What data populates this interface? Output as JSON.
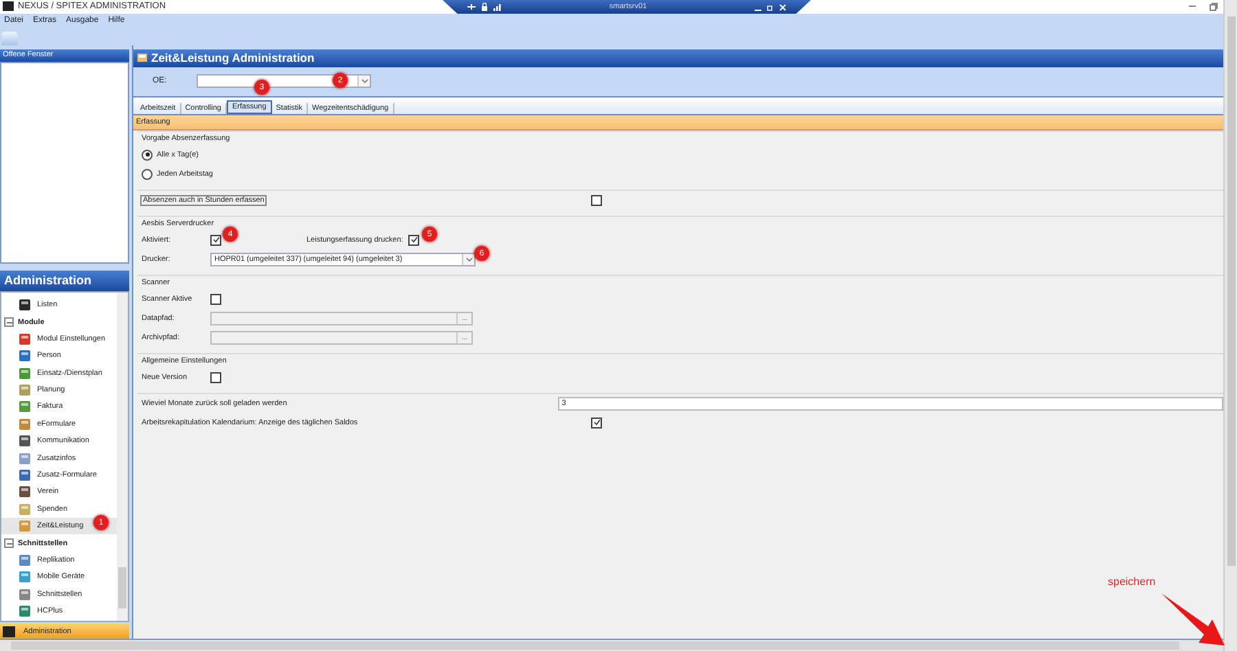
{
  "window": {
    "title": "NEXUS / SPITEX ADMINISTRATION",
    "remote_host": "smartsrv01"
  },
  "menu": [
    "Datei",
    "Extras",
    "Ausgabe",
    "Hilfe"
  ],
  "open_windows": {
    "title": "Offene Fenster"
  },
  "navigation": {
    "title": "Administration",
    "items": [
      {
        "kind": "item",
        "label": "Listen",
        "selected": false
      },
      {
        "kind": "group",
        "label": "Module",
        "expanded": true,
        "children": [
          {
            "kind": "item",
            "label": "Modul Einstellungen",
            "selected": false
          },
          {
            "kind": "item",
            "label": "Person",
            "selected": false
          },
          {
            "kind": "item",
            "label": "Einsatz-/Dienstplan",
            "selected": false
          },
          {
            "kind": "item",
            "label": "Planung",
            "selected": false
          },
          {
            "kind": "item",
            "label": "Faktura",
            "selected": false
          },
          {
            "kind": "item",
            "label": "eFormulare",
            "selected": false
          },
          {
            "kind": "item",
            "label": "Kommunikation",
            "selected": false
          },
          {
            "kind": "item",
            "label": "Zusatzinfos",
            "selected": false
          },
          {
            "kind": "item",
            "label": "Zusatz-Formulare",
            "selected": false
          },
          {
            "kind": "item",
            "label": "Verein",
            "selected": false
          },
          {
            "kind": "item",
            "label": "Spenden",
            "selected": false
          },
          {
            "kind": "item",
            "label": "Zeit&Leistung",
            "selected": true
          }
        ]
      },
      {
        "kind": "group",
        "label": "Schnittstellen",
        "expanded": true,
        "children": [
          {
            "kind": "item",
            "label": "Replikation",
            "selected": false
          },
          {
            "kind": "item",
            "label": "Mobile Geräte",
            "selected": false
          },
          {
            "kind": "item",
            "label": "Schnittstellen",
            "selected": false
          },
          {
            "kind": "item",
            "label": "HCPlus",
            "selected": false
          }
        ]
      }
    ]
  },
  "footer_tab": {
    "label": "Administration"
  },
  "document": {
    "title": "Zeit&Leistung Administration",
    "oe_label": "OE:",
    "tabs": [
      {
        "label": "Arbeitszeit",
        "selected": false
      },
      {
        "label": "Controlling",
        "selected": false
      },
      {
        "label": "Erfassung",
        "selected": true
      },
      {
        "label": "Statistik",
        "selected": false
      },
      {
        "label": "Wegzeitentschädigung",
        "selected": false
      }
    ],
    "section_header": "Erfassung",
    "sections": [
      {
        "title": "Vorgabe Absenzerfassung",
        "rows": [
          {
            "kind": "radio",
            "label": "Alle x Tag(e)",
            "selected": true
          },
          {
            "kind": "radio",
            "label": "Jeden Arbeitstag",
            "selected": false
          }
        ]
      },
      {
        "rows": [
          {
            "kind": "wide_check",
            "label": "Absenzen auch in Stunden erfassen",
            "focused": true,
            "checked": false
          }
        ]
      },
      {
        "title": "Aesbis Serverdrucker",
        "rows": [
          {
            "kind": "check_pair",
            "label": "Aktiviert:",
            "checked": true,
            "label_2": "Leistungserfassung drucken:",
            "checked_2": true
          },
          {
            "kind": "dropdown",
            "label": "Drucker:",
            "value": "HOPR01 (umgeleitet 337) (umgeleitet 94) (umgeleitet 3)"
          }
        ]
      },
      {
        "title": "Scanner",
        "rows": [
          {
            "kind": "check",
            "label": "Scanner Aktive",
            "checked": false
          },
          {
            "kind": "path",
            "label": "Datapfad:",
            "button": "..."
          },
          {
            "kind": "path",
            "label": "Archivpfad:",
            "button": "..."
          }
        ]
      },
      {
        "title": "Allgemeine Einstellungen",
        "rows": [
          {
            "kind": "check",
            "label": "Neue Version",
            "checked": false
          }
        ]
      },
      {
        "rows": [
          {
            "kind": "number",
            "label": "Wieviel Monate zurück soll geladen werden",
            "value": "3"
          },
          {
            "kind": "wide_check",
            "label": "Arbeitsrekapitulation Kalendarium: Anzeige des täglichen Saldos",
            "focused": false,
            "checked": true
          }
        ]
      }
    ]
  },
  "annotations": [
    {
      "label": "1"
    },
    {
      "label": "2"
    },
    {
      "label": "3"
    },
    {
      "label": "4"
    },
    {
      "label": "5"
    },
    {
      "label": "6"
    }
  ],
  "callout": {
    "label": "speichern"
  }
}
